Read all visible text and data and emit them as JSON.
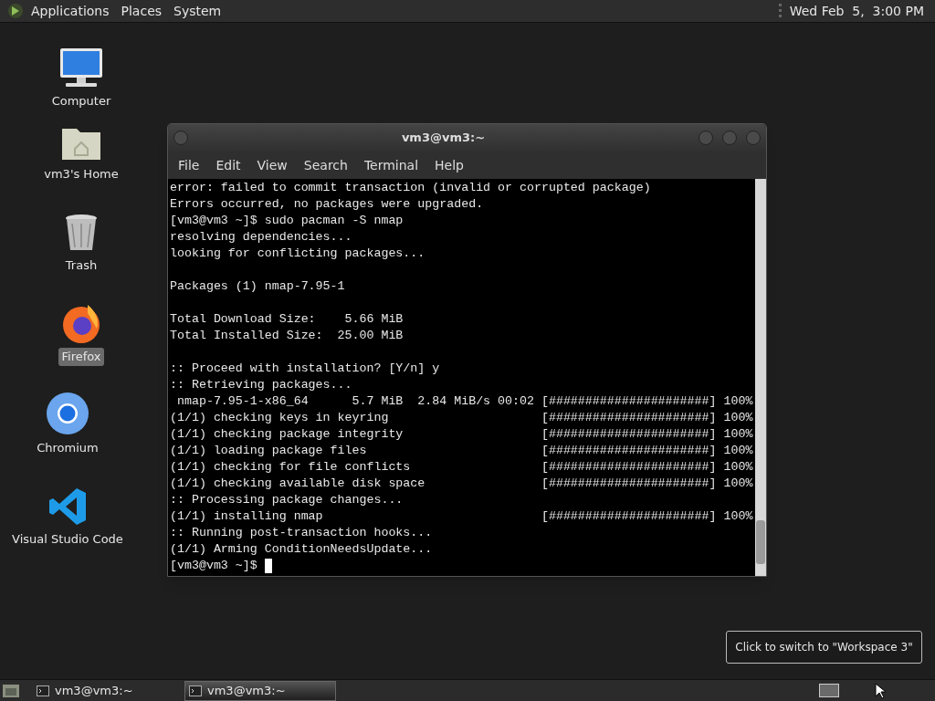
{
  "top_panel": {
    "menus": [
      "Applications",
      "Places",
      "System"
    ],
    "clock": "Wed Feb  5,  3:00 PM"
  },
  "desktop_icons": [
    {
      "kind": "computer",
      "label": "Computer",
      "selected": false
    },
    {
      "kind": "home",
      "label": "vm3's Home",
      "selected": false
    },
    {
      "kind": "trash",
      "label": "Trash",
      "selected": false
    },
    {
      "kind": "firefox",
      "label": "Firefox",
      "selected": true
    },
    {
      "kind": "chromium",
      "label": "Chromium",
      "selected": false
    },
    {
      "kind": "vscode",
      "label": "Visual Studio Code",
      "selected": false
    }
  ],
  "terminal": {
    "title": "vm3@vm3:~",
    "menu": [
      "File",
      "Edit",
      "View",
      "Search",
      "Terminal",
      "Help"
    ],
    "blocks": [
      [
        {
          "kind": "text",
          "text": "error: failed to commit transaction (invalid or corrupted package)"
        },
        {
          "kind": "text",
          "text": "Errors occurred, no packages were upgraded."
        },
        {
          "kind": "text",
          "text": "[vm3@vm3 ~]$ sudo pacman -S nmap"
        },
        {
          "kind": "text",
          "text": "resolving dependencies..."
        },
        {
          "kind": "text",
          "text": "looking for conflicting packages..."
        }
      ],
      [
        {
          "kind": "text",
          "text": "Packages (1) nmap-7.95-1"
        }
      ],
      [
        {
          "kind": "text",
          "text": "Total Download Size:    5.66 MiB"
        },
        {
          "kind": "text",
          "text": "Total Installed Size:  25.00 MiB"
        }
      ],
      [
        {
          "kind": "text",
          "text": ":: Proceed with installation? [Y/n] y"
        },
        {
          "kind": "text",
          "text": ":: Retrieving packages..."
        },
        {
          "kind": "progress",
          "text": " nmap-7.95-1-x86_64      5.7 MiB  2.84 MiB/s 00:02",
          "bar": "[######################]",
          "percent": "100%"
        },
        {
          "kind": "progress",
          "text": "(1/1) checking keys in keyring",
          "bar": "[######################]",
          "percent": "100%"
        },
        {
          "kind": "progress",
          "text": "(1/1) checking package integrity",
          "bar": "[######################]",
          "percent": "100%"
        },
        {
          "kind": "progress",
          "text": "(1/1) loading package files",
          "bar": "[######################]",
          "percent": "100%"
        },
        {
          "kind": "progress",
          "text": "(1/1) checking for file conflicts",
          "bar": "[######################]",
          "percent": "100%"
        },
        {
          "kind": "progress",
          "text": "(1/1) checking available disk space",
          "bar": "[######################]",
          "percent": "100%"
        },
        {
          "kind": "text",
          "text": ":: Processing package changes..."
        },
        {
          "kind": "progress",
          "text": "(1/1) installing nmap",
          "bar": "[######################]",
          "percent": "100%"
        },
        {
          "kind": "text",
          "text": ":: Running post-transaction hooks..."
        },
        {
          "kind": "text",
          "text": "(1/1) Arming ConditionNeedsUpdate..."
        },
        {
          "kind": "prompt",
          "text": "[vm3@vm3 ~]$ "
        }
      ]
    ]
  },
  "tooltip": "Click to switch to \"Workspace 3\"",
  "taskbar": {
    "items": [
      {
        "label": "vm3@vm3:~",
        "selected": false
      },
      {
        "label": "vm3@vm3:~",
        "selected": true
      }
    ]
  }
}
